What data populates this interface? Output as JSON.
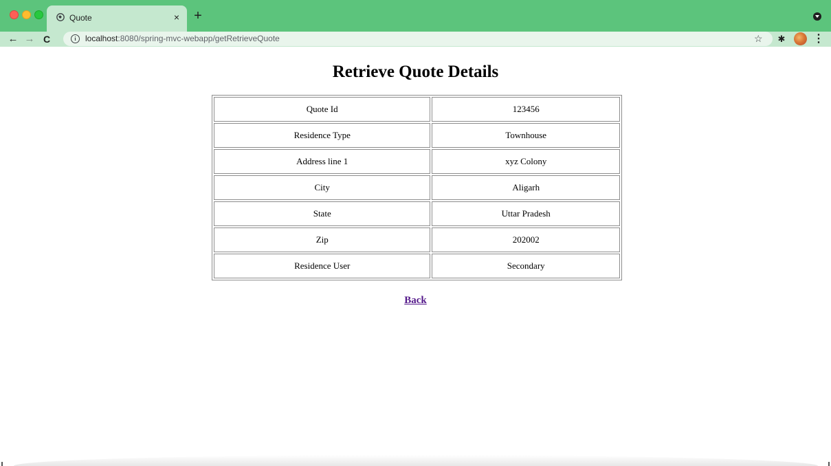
{
  "browser": {
    "tab": {
      "title": "Quote",
      "close_glyph": "×",
      "icon": "globe-icon"
    },
    "new_tab_glyph": "+",
    "nav": {
      "back_glyph": "←",
      "forward_glyph": "→",
      "reload_glyph": "C"
    },
    "address_bar": {
      "info_glyph": "i",
      "url_host": "localhost",
      "url_rest": ":8080/spring-mvc-webapp/getRetrieveQuote"
    },
    "star_glyph": "☆",
    "extensions_glyph": "✱",
    "menu_glyph": "⋮",
    "colors": {
      "tabbar": "#5cc47c",
      "toolbar": "#c5e8cf"
    }
  },
  "page": {
    "title": "Retrieve Quote Details",
    "rows": [
      {
        "label": "Quote Id",
        "value": "123456"
      },
      {
        "label": "Residence Type",
        "value": "Townhouse"
      },
      {
        "label": "Address line 1",
        "value": "xyz Colony"
      },
      {
        "label": "City",
        "value": "Aligarh"
      },
      {
        "label": "State",
        "value": "Uttar Pradesh"
      },
      {
        "label": "Zip",
        "value": "202002"
      },
      {
        "label": "Residence User",
        "value": "Secondary"
      }
    ],
    "back_link": "Back",
    "colors": {
      "link_visited": "#551a8b"
    }
  }
}
